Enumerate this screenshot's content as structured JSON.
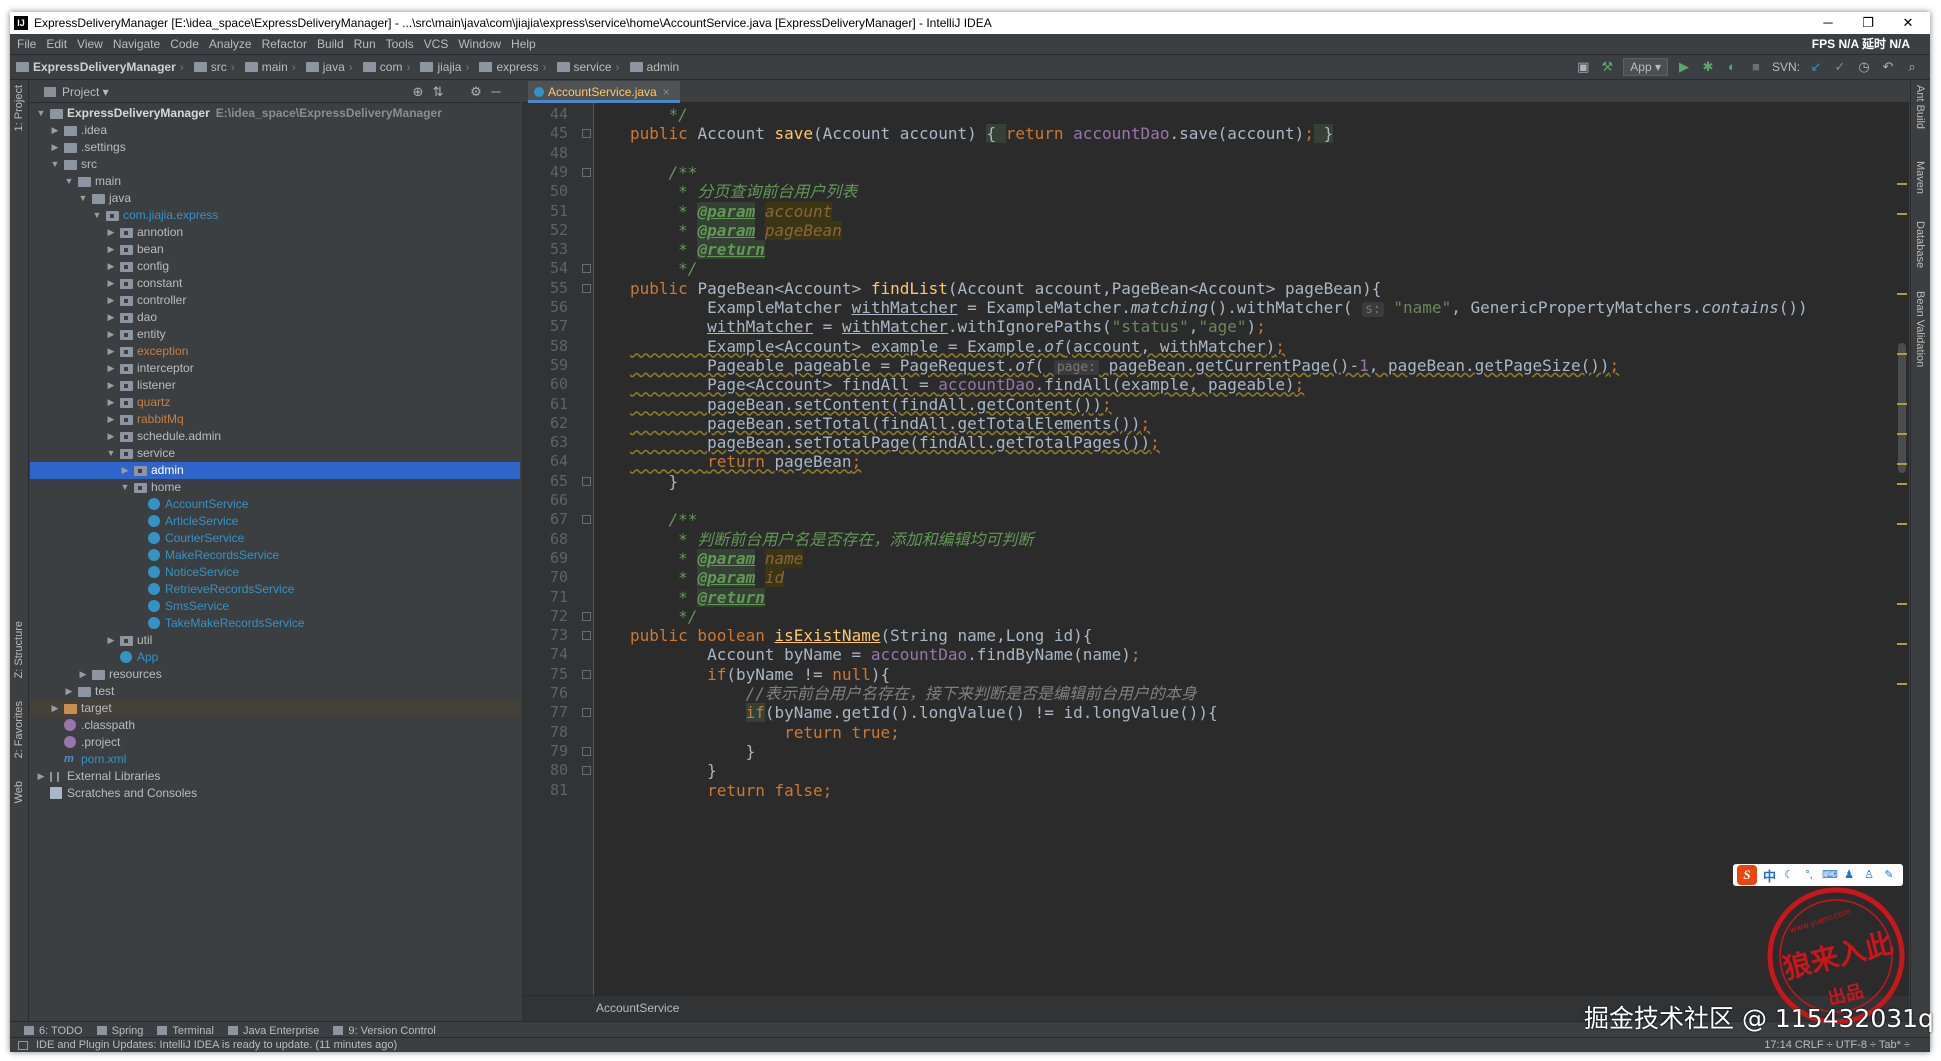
{
  "window": {
    "title": "ExpressDeliveryManager [E:\\idea_space\\ExpressDeliveryManager] - ...\\src\\main\\java\\com\\jiajia\\express\\service\\home\\AccountService.java [ExpressDeliveryManager] - IntelliJ IDEA",
    "logo": "IJ",
    "minimize": "─",
    "maximize": "❐",
    "close": "✕"
  },
  "menu": {
    "items": [
      "File",
      "Edit",
      "View",
      "Navigate",
      "Code",
      "Analyze",
      "Refactor",
      "Build",
      "Run",
      "Tools",
      "VCS",
      "Window",
      "Help"
    ],
    "fps": "FPS  N/A  延时  N/A"
  },
  "breadcrumbs": [
    "ExpressDeliveryManager",
    "src",
    "main",
    "java",
    "com",
    "jiajia",
    "express",
    "service",
    "admin"
  ],
  "toolbar": {
    "run_config": "App ▾",
    "svn_label": "SVN:",
    "icons": [
      "build-icon",
      "hammer-icon",
      "run-icon",
      "debug-icon",
      "coverage-icon",
      "stop-icon",
      "svn-update-icon",
      "svn-commit-icon",
      "history-icon",
      "revert-icon",
      "search-icon"
    ]
  },
  "left_strip": {
    "project": "1: Project",
    "structure": "Z: Structure",
    "favorites": "2: Favorites",
    "web": "Web"
  },
  "right_strip": {
    "ant": "Ant Build",
    "maven": "Maven",
    "database": "Database",
    "bean": "Bean Validation"
  },
  "project_panel": {
    "title": "Project ▾",
    "tree": [
      {
        "label": "ExpressDeliveryManager",
        "sub": "E:\\idea_space\\ExpressDeliveryManager",
        "level": 0,
        "arrow": "▼",
        "icon": "folder",
        "style": "boldl"
      },
      {
        "label": ".idea",
        "level": 1,
        "arrow": "▶",
        "icon": "folder"
      },
      {
        "label": ".settings",
        "level": 1,
        "arrow": "▶",
        "icon": "folder"
      },
      {
        "label": "src",
        "level": 1,
        "arrow": "▼",
        "icon": "folder"
      },
      {
        "label": "main",
        "level": 2,
        "arrow": "▼",
        "icon": "folder"
      },
      {
        "label": "java",
        "level": 3,
        "arrow": "▼",
        "icon": "folder"
      },
      {
        "label": "com.jiajia.express",
        "level": 4,
        "arrow": "▼",
        "icon": "pkg",
        "style": "blue"
      },
      {
        "label": "annotion",
        "level": 5,
        "arrow": "▶",
        "icon": "pkg"
      },
      {
        "label": "bean",
        "level": 5,
        "arrow": "▶",
        "icon": "pkg"
      },
      {
        "label": "config",
        "level": 5,
        "arrow": "▶",
        "icon": "pkg"
      },
      {
        "label": "constant",
        "level": 5,
        "arrow": "▶",
        "icon": "pkg"
      },
      {
        "label": "controller",
        "level": 5,
        "arrow": "▶",
        "icon": "pkg"
      },
      {
        "label": "dao",
        "level": 5,
        "arrow": "▶",
        "icon": "pkg"
      },
      {
        "label": "entity",
        "level": 5,
        "arrow": "▶",
        "icon": "pkg"
      },
      {
        "label": "exception",
        "level": 5,
        "arrow": "▶",
        "icon": "pkg",
        "style": "gone"
      },
      {
        "label": "interceptor",
        "level": 5,
        "arrow": "▶",
        "icon": "pkg"
      },
      {
        "label": "listener",
        "level": 5,
        "arrow": "▶",
        "icon": "pkg"
      },
      {
        "label": "quartz",
        "level": 5,
        "arrow": "▶",
        "icon": "pkg",
        "style": "gone"
      },
      {
        "label": "rabbitMq",
        "level": 5,
        "arrow": "▶",
        "icon": "pkg",
        "style": "gone"
      },
      {
        "label": "schedule.admin",
        "level": 5,
        "arrow": "▶",
        "icon": "pkg"
      },
      {
        "label": "service",
        "level": 5,
        "arrow": "▼",
        "icon": "pkg"
      },
      {
        "label": "admin",
        "level": 6,
        "arrow": "▶",
        "icon": "pkg",
        "style": "sel"
      },
      {
        "label": "home",
        "level": 6,
        "arrow": "▼",
        "icon": "pkg"
      },
      {
        "label": "AccountService",
        "level": 7,
        "arrow": "",
        "icon": "cls",
        "style": "blue"
      },
      {
        "label": "ArticleService",
        "level": 7,
        "arrow": "",
        "icon": "cls",
        "style": "blue"
      },
      {
        "label": "CourierService",
        "level": 7,
        "arrow": "",
        "icon": "cls",
        "style": "blue"
      },
      {
        "label": "MakeRecordsService",
        "level": 7,
        "arrow": "",
        "icon": "cls",
        "style": "blue"
      },
      {
        "label": "NoticeService",
        "level": 7,
        "arrow": "",
        "icon": "cls",
        "style": "blue"
      },
      {
        "label": "RetrieveRecordsService",
        "level": 7,
        "arrow": "",
        "icon": "cls",
        "style": "blue"
      },
      {
        "label": "SmsService",
        "level": 7,
        "arrow": "",
        "icon": "cls",
        "style": "blue"
      },
      {
        "label": "TakeMakeRecordsService",
        "level": 7,
        "arrow": "",
        "icon": "cls",
        "style": "blue"
      },
      {
        "label": "util",
        "level": 5,
        "arrow": "▶",
        "icon": "pkg"
      },
      {
        "label": "App",
        "level": 5,
        "arrow": "",
        "icon": "cls",
        "style": "blue"
      },
      {
        "label": "resources",
        "level": 3,
        "arrow": "▶",
        "icon": "folder"
      },
      {
        "label": "test",
        "level": 2,
        "arrow": "▶",
        "icon": "folder"
      },
      {
        "label": "target",
        "level": 1,
        "arrow": "▶",
        "icon": "ora",
        "style": "target"
      },
      {
        "label": ".classpath",
        "level": 1,
        "arrow": "",
        "icon": "cp"
      },
      {
        "label": ".project",
        "level": 1,
        "arrow": "",
        "icon": "cp"
      },
      {
        "label": "pom.xml",
        "level": 1,
        "arrow": "",
        "icon": "xml",
        "style": "blue"
      },
      {
        "label": "External Libraries",
        "level": 0,
        "arrow": "▶",
        "icon": "lib"
      },
      {
        "label": "Scratches and Consoles",
        "level": 0,
        "arrow": "",
        "icon": "sc"
      }
    ]
  },
  "editor": {
    "tab": {
      "label": "AccountService.java",
      "close": "×"
    },
    "line_numbers": [
      "44",
      "45",
      "48",
      "49",
      "50",
      "51",
      "52",
      "53",
      "54",
      "55",
      "56",
      "57",
      "58",
      "59",
      "60",
      "61",
      "62",
      "63",
      "64",
      "65",
      "66",
      "67",
      "68",
      "69",
      "70",
      "71",
      "72",
      "73",
      "74",
      "75",
      "76",
      "77",
      "78",
      "79",
      "80",
      "81"
    ],
    "lines": [
      [
        [
          "cm",
          "    */"
        ]
      ],
      [
        [
          "kw",
          "public "
        ],
        [
          "",
          "Account "
        ],
        [
          "fn",
          "save"
        ],
        [
          "",
          "(Account account) "
        ],
        [
          "hl",
          "{ "
        ],
        [
          "kw",
          "return "
        ],
        [
          "fd",
          "accountDao"
        ],
        [
          "",
          ".save(account)"
        ],
        [
          "kw",
          ";"
        ],
        [
          "hl",
          " }"
        ]
      ],
      [
        [
          "",
          ""
        ]
      ],
      [
        [
          "cm",
          "    /**"
        ]
      ],
      [
        [
          "cm",
          "     * 分页查询前台用户列表"
        ]
      ],
      [
        [
          "cm",
          "     * "
        ],
        [
          "ct",
          "@param"
        ],
        [
          "cm",
          " "
        ],
        [
          "pv",
          "account"
        ]
      ],
      [
        [
          "cm",
          "     * "
        ],
        [
          "ct",
          "@param"
        ],
        [
          "cm",
          " "
        ],
        [
          "pv",
          "pageBean"
        ]
      ],
      [
        [
          "cm",
          "     * "
        ],
        [
          "ct",
          "@return"
        ]
      ],
      [
        [
          "cm",
          "     */"
        ]
      ],
      [
        [
          "kw",
          "public "
        ],
        [
          "",
          "PageBean<Account> "
        ],
        [
          "fn",
          "findList"
        ],
        [
          "",
          "(Account account,PageBean<Account> pageBean){"
        ]
      ],
      [
        [
          "",
          "        ExampleMatcher "
        ],
        [
          "ul",
          "withMatcher"
        ],
        [
          "",
          " = ExampleMatcher."
        ],
        [
          "it",
          "matching"
        ],
        [
          "",
          "().withMatcher( "
        ],
        [
          "hint",
          "s:"
        ],
        [
          "st",
          " \"name\""
        ],
        [
          "",
          ", GenericPropertyMatchers."
        ],
        [
          "it",
          "contains"
        ],
        [
          "",
          "())"
        ]
      ],
      [
        [
          "",
          "        "
        ],
        [
          "ul",
          "withMatcher"
        ],
        [
          "",
          " = "
        ],
        [
          "ul",
          "withMatcher"
        ],
        [
          "",
          ".withIgnorePaths("
        ],
        [
          "st",
          "\"status\""
        ],
        [
          "",
          ","
        ],
        [
          "st",
          "\"age\""
        ],
        [
          "",
          ")"
        ],
        [
          "kw",
          ";"
        ]
      ],
      [
        [
          "wv",
          "        Example<Account> example = Example."
        ],
        [
          "wv it",
          "of"
        ],
        [
          "wv",
          "(account, withMatcher)"
        ],
        [
          "kw wv",
          ";"
        ]
      ],
      [
        [
          "wv",
          "        Pageable pageable = PageRequest."
        ],
        [
          "wv it",
          "of"
        ],
        [
          "wv",
          "( "
        ],
        [
          "hint",
          "page:"
        ],
        [
          "wv",
          " pageBean.getCurrentPage()-"
        ],
        [
          "wv fd",
          "1"
        ],
        [
          "wv",
          ", pageBean.getPageSize())"
        ],
        [
          "kw wv",
          ";"
        ]
      ],
      [
        [
          "wv",
          "        Page<Account> findAll = "
        ],
        [
          "wv fd",
          "accountDao"
        ],
        [
          "wv",
          ".findAll(example, pageable)"
        ],
        [
          "kw wv",
          ";"
        ]
      ],
      [
        [
          "wv",
          "        pageBean.setContent(findAll.getContent())"
        ],
        [
          "kw wv",
          ";"
        ]
      ],
      [
        [
          "wv",
          "        pageBean.setTotal(findAll.getTotalElements())"
        ],
        [
          "kw wv",
          ";"
        ]
      ],
      [
        [
          "wv",
          "        pageBean.setTotalPage(findAll.getTotalPages())"
        ],
        [
          "kw wv",
          ";"
        ]
      ],
      [
        [
          "wv",
          "        "
        ],
        [
          "kw wv",
          "return "
        ],
        [
          "wv",
          "pageBean"
        ],
        [
          "kw wv",
          ";"
        ]
      ],
      [
        [
          "",
          "    }"
        ]
      ],
      [
        [
          "",
          ""
        ]
      ],
      [
        [
          "cm",
          "    /**"
        ]
      ],
      [
        [
          "cm",
          "     * 判断前台用户名是否存在，添加和编辑均可判断"
        ]
      ],
      [
        [
          "cm",
          "     * "
        ],
        [
          "ct",
          "@param"
        ],
        [
          "cm",
          " "
        ],
        [
          "pv",
          "name"
        ]
      ],
      [
        [
          "cm",
          "     * "
        ],
        [
          "ct",
          "@param"
        ],
        [
          "cm",
          " "
        ],
        [
          "pv",
          "id"
        ]
      ],
      [
        [
          "cm",
          "     * "
        ],
        [
          "ct",
          "@return"
        ]
      ],
      [
        [
          "cm",
          "     */"
        ]
      ],
      [
        [
          "kw",
          "public boolean "
        ],
        [
          "fn ul",
          "isExistName"
        ],
        [
          "",
          "(String name,Long id){"
        ]
      ],
      [
        [
          "",
          "        Account byName = "
        ],
        [
          "fd",
          "accountDao"
        ],
        [
          "",
          ".findByName(name)"
        ],
        [
          "kw",
          ";"
        ]
      ],
      [
        [
          "kw",
          "        if"
        ],
        [
          "",
          "(byName != "
        ],
        [
          "kw",
          "null"
        ],
        [
          "",
          "){"
        ]
      ],
      [
        [
          "lc",
          "            //表示前台用户名存在，接下来判断是否是编辑前台用户的本身"
        ]
      ],
      [
        [
          "",
          "            "
        ],
        [
          "kw hl",
          "if"
        ],
        [
          "",
          "(byName.getId().longValue() != id.longValue()){"
        ]
      ],
      [
        [
          "kw",
          "                return true"
        ],
        [
          "kw",
          ";"
        ]
      ],
      [
        [
          "",
          "            }"
        ]
      ],
      [
        [
          "",
          "        }"
        ]
      ],
      [
        [
          "kw",
          "        return false"
        ],
        [
          "kw",
          ";"
        ]
      ]
    ],
    "breadcrumb": "AccountService"
  },
  "bottom_tabs": [
    "6: TODO",
    "Spring",
    "Terminal",
    "Java Enterprise",
    "9: Version Control"
  ],
  "status": {
    "message": "IDE and Plugin Updates: IntelliJ IDEA is ready to update. (11 minutes ago)",
    "position": "17:14  CRLF ÷  UTF-8 ÷  Tab* ÷"
  },
  "watermark": "掘金技术社区 @ 115432031q",
  "ime": {
    "logo": "S",
    "lang": "中"
  },
  "stamp": {
    "top": "www.yuenr.com",
    "main": "狼来入此",
    "sub": "出品"
  }
}
